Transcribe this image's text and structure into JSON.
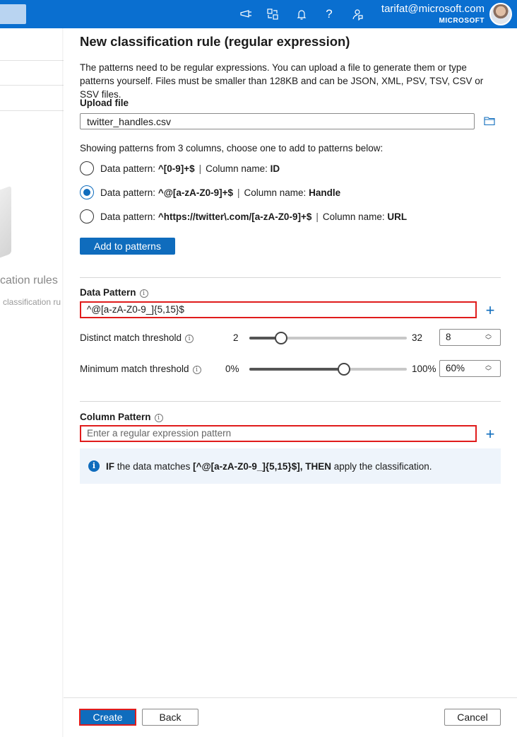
{
  "topbar": {
    "email": "tarifat@microsoft.com",
    "tenant": "MICROSOFT",
    "icons": [
      "announcement-icon",
      "switch-directory-icon",
      "notifications-icon",
      "help-icon",
      "feedback-icon"
    ]
  },
  "background": {
    "title": "cation rules",
    "subtitle": "classification ru"
  },
  "panel": {
    "title": "New classification rule (regular expression)",
    "description": "The patterns need to be regular expressions. You can upload a file to generate them or type patterns yourself. Files must be smaller than 128KB and can be JSON, XML, PSV, TSV, CSV or SSV files.",
    "upload": {
      "label": "Upload file",
      "value": "twitter_handles.csv"
    },
    "showing_text": "Showing patterns from 3 columns, choose one to add to patterns below:",
    "patterns": [
      {
        "prefix": "Data pattern:",
        "pattern": "^[0-9]+$",
        "sep": "|",
        "col_label": "Column name:",
        "column": "ID",
        "selected": false
      },
      {
        "prefix": "Data pattern:",
        "pattern": "^@[a-zA-Z0-9]+$",
        "sep": "|",
        "col_label": "Column name:",
        "column": "Handle",
        "selected": true
      },
      {
        "prefix": "Data pattern:",
        "pattern": "^https://twitter\\.com/[a-zA-Z0-9]+$",
        "sep": "|",
        "col_label": "Column name:",
        "column": "URL",
        "selected": false
      }
    ],
    "add_button": "Add to patterns",
    "data_pattern": {
      "label": "Data Pattern",
      "value": "^@[a-zA-Z0-9_]{5,15}$"
    },
    "distinct": {
      "label": "Distinct match threshold",
      "min": "2",
      "max": "32",
      "value": "8",
      "level": 0.2
    },
    "minimum": {
      "label": "Minimum match threshold",
      "min": "0%",
      "max": "100%",
      "value": "60%",
      "level": 0.6
    },
    "column_pattern": {
      "label": "Column Pattern",
      "placeholder": "Enter a regular expression pattern"
    },
    "info": {
      "if": "IF",
      "text1": "the data matches",
      "pattern": "[^@[a-zA-Z0-9_]{5,15}$],",
      "then": "THEN",
      "text2": "apply the classification."
    },
    "footer": {
      "create": "Create",
      "back": "Back",
      "cancel": "Cancel"
    }
  }
}
